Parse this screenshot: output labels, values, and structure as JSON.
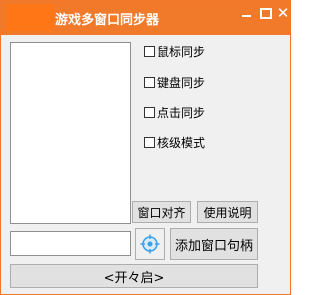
{
  "window": {
    "title": "游戏多窗口同步器",
    "controls": {
      "minimize": "minimize-icon",
      "maximize": "maximize-icon",
      "close": "close-icon"
    }
  },
  "options": [
    {
      "label": "鼠标同步",
      "checked": false
    },
    {
      "label": "键盘同步",
      "checked": false
    },
    {
      "label": "点击同步",
      "checked": false
    },
    {
      "label": "核级模式",
      "checked": false
    }
  ],
  "buttons": {
    "align_windows": "窗口对齐",
    "help": "使用说明",
    "add_handle": "添加窗口句柄",
    "start": "<开々启>"
  },
  "input": {
    "value": ""
  },
  "colors": {
    "titlebar": "#f07a2a",
    "accent": "#f07828",
    "icon_blue": "#3aa0e8"
  }
}
